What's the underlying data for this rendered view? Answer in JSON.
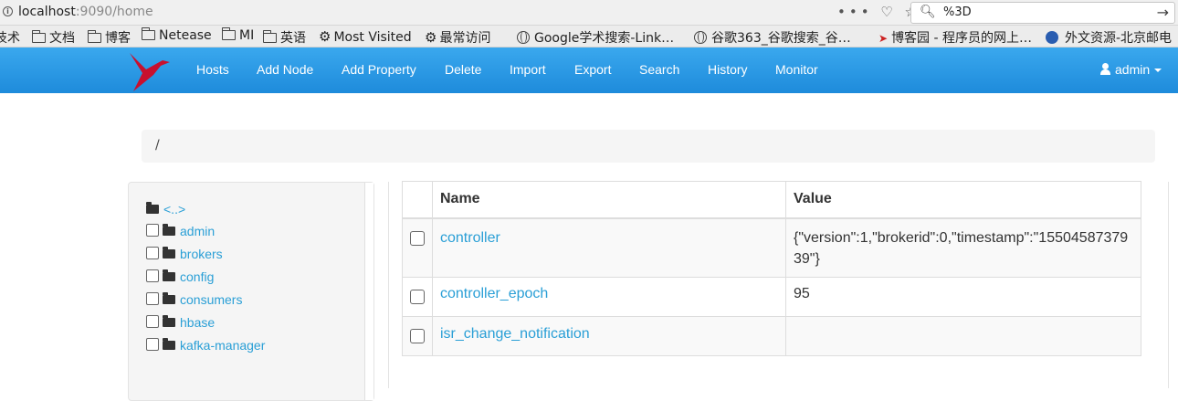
{
  "browser": {
    "url_host": "localhost",
    "url_rest": ":9090/home",
    "page_actions": "••• ♡ ☆",
    "search_query": "%3D"
  },
  "bookmarks": [
    {
      "label": "技术",
      "icon": "none"
    },
    {
      "label": "文档",
      "icon": "folder-icon"
    },
    {
      "label": "博客",
      "icon": "folder-icon"
    },
    {
      "label": "Netease",
      "icon": "folder-icon"
    },
    {
      "label": "MI",
      "icon": "folder-icon"
    },
    {
      "label": "英语",
      "icon": "folder-icon"
    },
    {
      "label": "Most Visited",
      "icon": "gear-icon"
    },
    {
      "label": "最常访问",
      "icon": "gear-icon"
    },
    {
      "label": "Google学术搜索-Link…",
      "icon": "globe-icon"
    },
    {
      "label": "谷歌363_谷歌搜索_谷…",
      "icon": "globe-icon"
    },
    {
      "label": "博客园 - 程序员的网上…",
      "icon": "bird-icon"
    },
    {
      "label": "外文资源-北京邮电",
      "icon": "blue-circle-icon"
    }
  ],
  "navbar": {
    "items": [
      "Hosts",
      "Add Node",
      "Add Property",
      "Delete",
      "Import",
      "Export",
      "Search",
      "History",
      "Monitor"
    ],
    "user": "admin",
    "brand_color": "#c8102e",
    "bar_color": "#2a9fd6"
  },
  "breadcrumb": "/",
  "tree": {
    "parent": "<..>",
    "items": [
      "admin",
      "brokers",
      "config",
      "consumers",
      "hbase",
      "kafka-manager"
    ]
  },
  "table": {
    "headers": [
      "Name",
      "Value"
    ],
    "rows": [
      {
        "name": "controller",
        "value": "{\"version\":1,\"brokerid\":0,\"timestamp\":\"1550458737939\"}"
      },
      {
        "name": "controller_epoch",
        "value": "95"
      },
      {
        "name": "isr_change_notification",
        "value": ""
      }
    ]
  }
}
